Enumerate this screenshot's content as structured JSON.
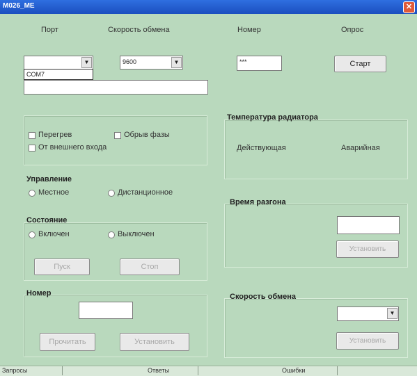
{
  "window": {
    "title": "M026_ME",
    "close_icon": "close-icon"
  },
  "top": {
    "port_label": "Порт",
    "speed_label": "Скорость обмена",
    "number_label": "Номер",
    "poll_label": "Опрос",
    "port_value": "",
    "port_dropdown_option": "COM7",
    "speed_value": "9600",
    "number_value": "***",
    "start_button": "Старт"
  },
  "alarms": {
    "overheat": "Перегрев",
    "phase_break": "Обрыв фазы",
    "external_input": "От внешнего входа"
  },
  "control": {
    "title": "Управление",
    "local": "Местное",
    "remote": "Дистанционное"
  },
  "state": {
    "title": "Состояние",
    "on": "Включен",
    "off": "Выключен",
    "start_button": "Пуск",
    "stop_button": "Стоп"
  },
  "number": {
    "title": "Номер",
    "read_button": "Прочитать",
    "set_button": "Установить"
  },
  "radiator": {
    "title": "Температура радиатора",
    "current": "Действующая",
    "alarm": "Аварийная"
  },
  "accel": {
    "title": "Время разгона",
    "set_button": "Установить"
  },
  "exchange": {
    "title": "Скорость обмена",
    "set_button": "Установить"
  },
  "status": {
    "requests": "Запросы",
    "answers": "Ответы",
    "errors": "Ошибки"
  }
}
